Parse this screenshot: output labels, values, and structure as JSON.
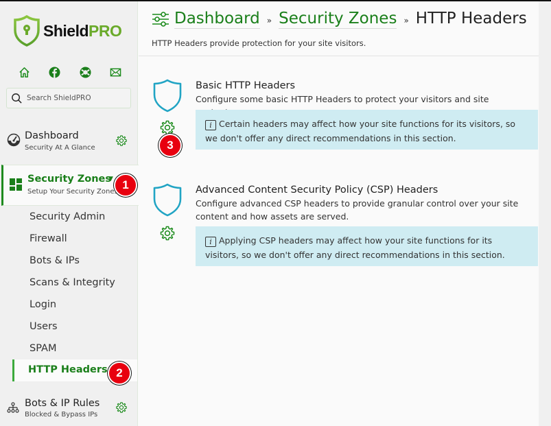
{
  "app": {
    "brand_name_part1": "Shield",
    "brand_name_part2": "PRO",
    "brand_color": "#6aaa2a",
    "accent_color": "#1a7f1a"
  },
  "sidebar": {
    "quick_icons": [
      "home-icon",
      "facebook-icon",
      "lifebuoy-icon",
      "mail-icon"
    ],
    "search": {
      "placeholder": "Search ShieldPRO",
      "value": ""
    },
    "dashboard": {
      "title": "Dashboard",
      "subtitle": "Security At A Glance"
    },
    "security_zones": {
      "title": "Security Zones",
      "subtitle": "Setup Your Security Zones",
      "expanded": true,
      "items": [
        {
          "label": "Security Admin"
        },
        {
          "label": "Firewall"
        },
        {
          "label": "Bots & IPs"
        },
        {
          "label": "Scans & Integrity"
        },
        {
          "label": "Login"
        },
        {
          "label": "Users"
        },
        {
          "label": "SPAM"
        },
        {
          "label": "HTTP Headers",
          "active": true
        }
      ]
    },
    "bots_rules": {
      "title": "Bots & IP Rules",
      "subtitle": "Blocked & Bypass IPs"
    }
  },
  "header": {
    "breadcrumbs": [
      {
        "label": "Dashboard"
      },
      {
        "label": "Security Zones"
      }
    ],
    "separator": "»",
    "current": "HTTP Headers",
    "description": "HTTP Headers provide protection for your site visitors."
  },
  "sections": [
    {
      "title": "Basic HTTP Headers",
      "description": "Configure some basic HTTP Headers to protect your visitors and site content.",
      "alert": "Certain headers may affect how your site functions for its visitors, so we don't offer any direct recommendations in this section."
    },
    {
      "title": "Advanced Content Security Policy (CSP) Headers",
      "description": "Configure advanced CSP headers to provide granular control over your site content and how assets are served.",
      "alert": "Applying CSP headers may affect how your site functions for its visitors, so we don't offer any direct recommendations in this section."
    }
  ],
  "annotations": [
    {
      "number": "1",
      "target": "Security Zones"
    },
    {
      "number": "2",
      "target": "HTTP Headers"
    },
    {
      "number": "3",
      "target": "Basic HTTP Headers settings"
    }
  ],
  "info_glyph": "i"
}
